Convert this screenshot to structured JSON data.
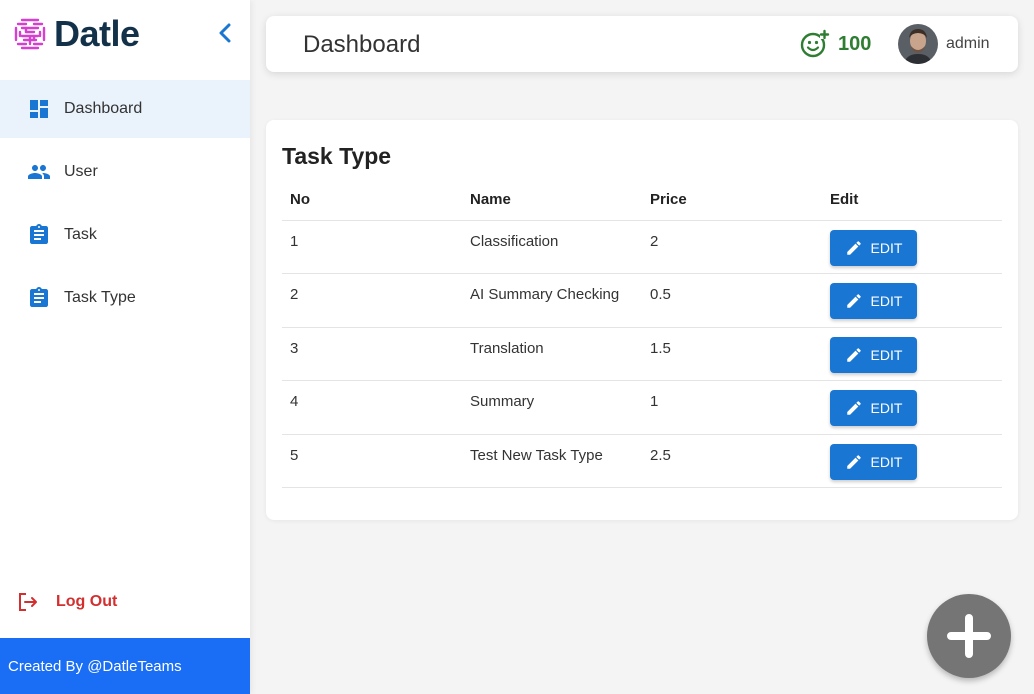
{
  "brand": {
    "name": "Datle"
  },
  "sidebar": {
    "items": [
      {
        "label": "Dashboard",
        "icon": "dashboard-icon",
        "active": true
      },
      {
        "label": "User",
        "icon": "users-icon",
        "active": false
      },
      {
        "label": "Task",
        "icon": "clipboard-icon",
        "active": false
      },
      {
        "label": "Task Type",
        "icon": "clipboard-icon",
        "active": false
      }
    ],
    "logout_label": "Log Out",
    "footer_text": "Created By @DatleTeams"
  },
  "header": {
    "title": "Dashboard",
    "points": "100",
    "username": "admin"
  },
  "task_type": {
    "title": "Task Type",
    "columns": [
      "No",
      "Name",
      "Price",
      "Edit"
    ],
    "edit_label": "EDIT",
    "rows": [
      {
        "no": "1",
        "name": "Classification",
        "price": "2"
      },
      {
        "no": "2",
        "name": "AI Summary Checking",
        "price": "0.5"
      },
      {
        "no": "3",
        "name": "Translation",
        "price": "1.5"
      },
      {
        "no": "4",
        "name": "Summary",
        "price": "1"
      },
      {
        "no": "5",
        "name": "Test New Task Type",
        "price": "2.5"
      }
    ]
  },
  "colors": {
    "brand_dark": "#13324a",
    "logo_magenta": "#d63fd0",
    "primary": "#1976d2",
    "footer_blue": "#1a6ef5",
    "points_green": "#2e7d32",
    "logout_red": "#d32f2f",
    "active_bg": "#eaf2fc",
    "fab_gray": "#757575"
  }
}
